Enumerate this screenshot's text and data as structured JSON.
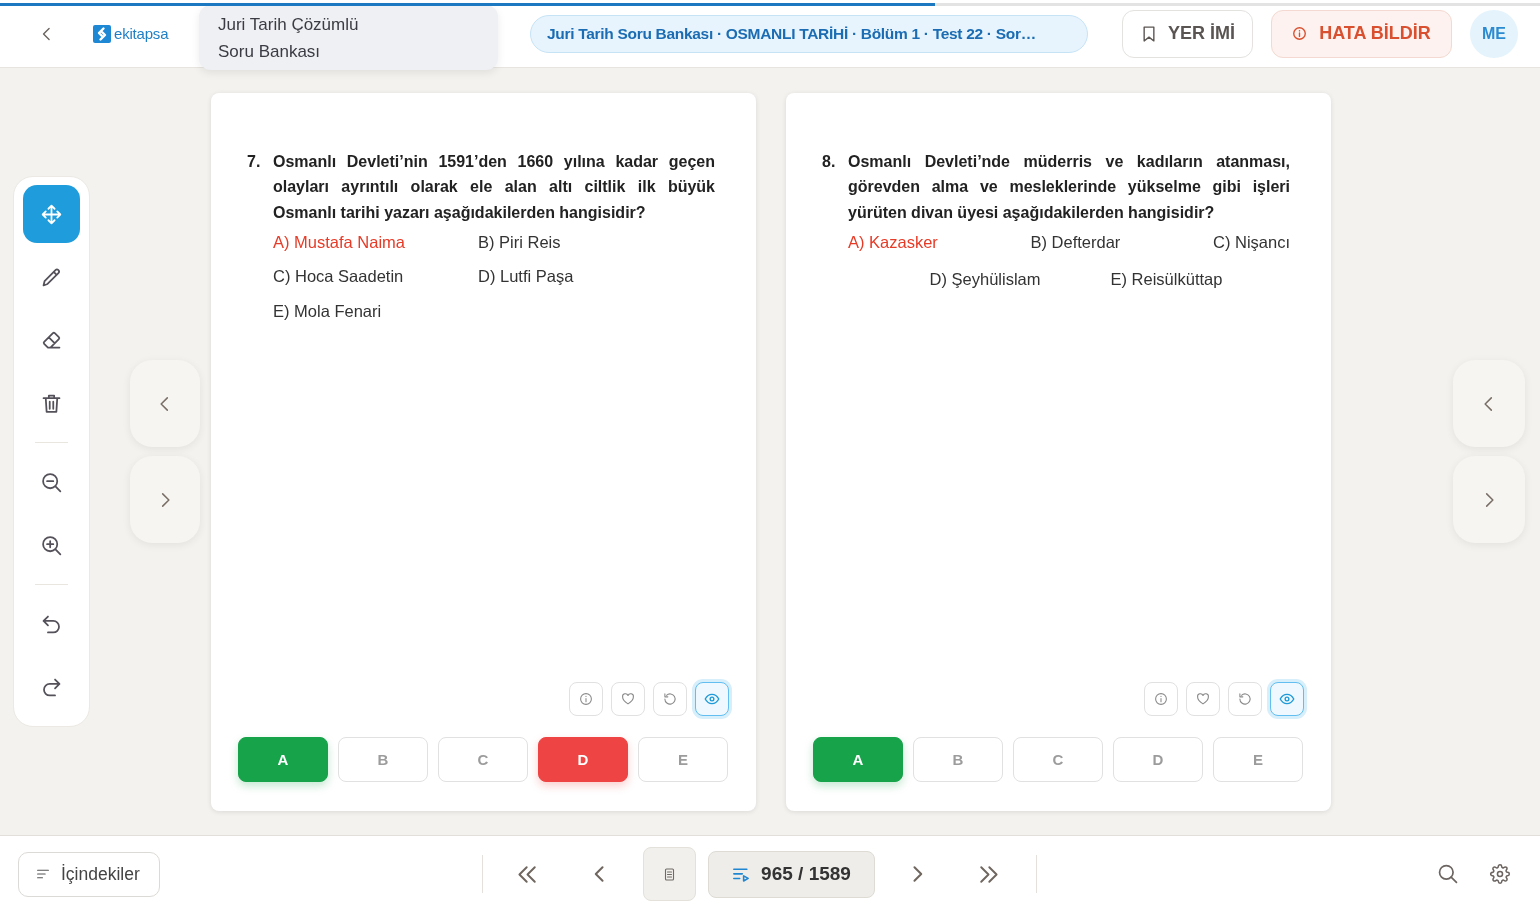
{
  "top_bar": {
    "progress": {
      "level": 0.607
    },
    "logo": "ekitapsa",
    "book_title": "Juri Tarih Çözümlü Soru Bankası",
    "breadcrumb": "Juri Tarih Soru Bankası · OSMANLI TARİHİ · Bölüm 1 · Test 22 · Sor…",
    "bookmark_button": "YER İMİ",
    "report_button": "HATA BİLDİR",
    "avatar": "ME"
  },
  "tool_groups": [
    [
      {
        "kind": "move",
        "selected": true
      },
      {
        "kind": "pencil",
        "selected": false
      },
      {
        "kind": "eraser",
        "selected": false
      },
      {
        "kind": "trash",
        "selected": false
      }
    ],
    [
      {
        "kind": "zoom-out",
        "selected": false
      },
      {
        "kind": "zoom-in",
        "selected": false
      }
    ],
    [
      {
        "kind": "undo",
        "selected": false
      },
      {
        "kind": "redo",
        "selected": false
      }
    ]
  ],
  "questions": [
    {
      "number": "7.",
      "text": "Osmanlı Devleti’nin 1591’den 1660 yılına kadar geçen olayları ayrıntılı olarak ele alan altı ciltlik ilk büyük Osmanlı tarihi yazarı aşağıdakilerden hangisidir?",
      "kind": "columns",
      "option_rows": [
        [
          {
            "text": "A) Mustafa Naima",
            "correct": true
          },
          {
            "text": "B) Piri Reis",
            "correct": false
          }
        ],
        [
          {
            "text": "C) Hoca Saadetin",
            "correct": false
          },
          {
            "text": "D) Lutfi Paşa",
            "correct": false
          }
        ],
        [
          {
            "text": "E) Mola Fenari",
            "correct": false
          }
        ]
      ],
      "actions": [
        {
          "kind": "info",
          "active": false
        },
        {
          "kind": "heart",
          "active": false
        },
        {
          "kind": "reset",
          "active": false
        },
        {
          "kind": "eye",
          "active": true
        }
      ],
      "answers": [
        {
          "letter": "A",
          "correct": true,
          "wrong": false
        },
        {
          "letter": "B",
          "correct": false,
          "wrong": false
        },
        {
          "letter": "C",
          "correct": false,
          "wrong": false
        },
        {
          "letter": "D",
          "correct": false,
          "wrong": true
        },
        {
          "letter": "E",
          "correct": false,
          "wrong": false
        }
      ]
    },
    {
      "number": "8.",
      "text": "Osmanlı Devleti’nde müderris ve kadıların atanması, görevden alma ve mesleklerinde yükselme gibi işleri yürüten divan üyesi aşağıdakilerden hangisidir?",
      "kind": "spread",
      "option_rows": [
        [
          {
            "text": "A) Kazasker",
            "correct": true
          },
          {
            "text": "B) Defterdar",
            "correct": false
          },
          {
            "text": "C) Nişancı",
            "correct": false
          }
        ],
        [
          {
            "text": "D) Şeyhülislam",
            "correct": false
          },
          {
            "text": "E) Reisülküttap",
            "correct": false
          }
        ]
      ],
      "actions": [
        {
          "kind": "info",
          "active": false
        },
        {
          "kind": "heart",
          "active": false
        },
        {
          "kind": "reset",
          "active": false
        },
        {
          "kind": "eye",
          "active": true
        }
      ],
      "answers": [
        {
          "letter": "A",
          "correct": true,
          "wrong": false
        },
        {
          "letter": "B",
          "correct": false,
          "wrong": false
        },
        {
          "letter": "C",
          "correct": false,
          "wrong": false
        },
        {
          "letter": "D",
          "correct": false,
          "wrong": false
        },
        {
          "letter": "E",
          "correct": false,
          "wrong": false
        }
      ]
    }
  ],
  "bottom_bar": {
    "contents_button": "İçindekiler",
    "page_counter": "965 / 1589"
  }
}
